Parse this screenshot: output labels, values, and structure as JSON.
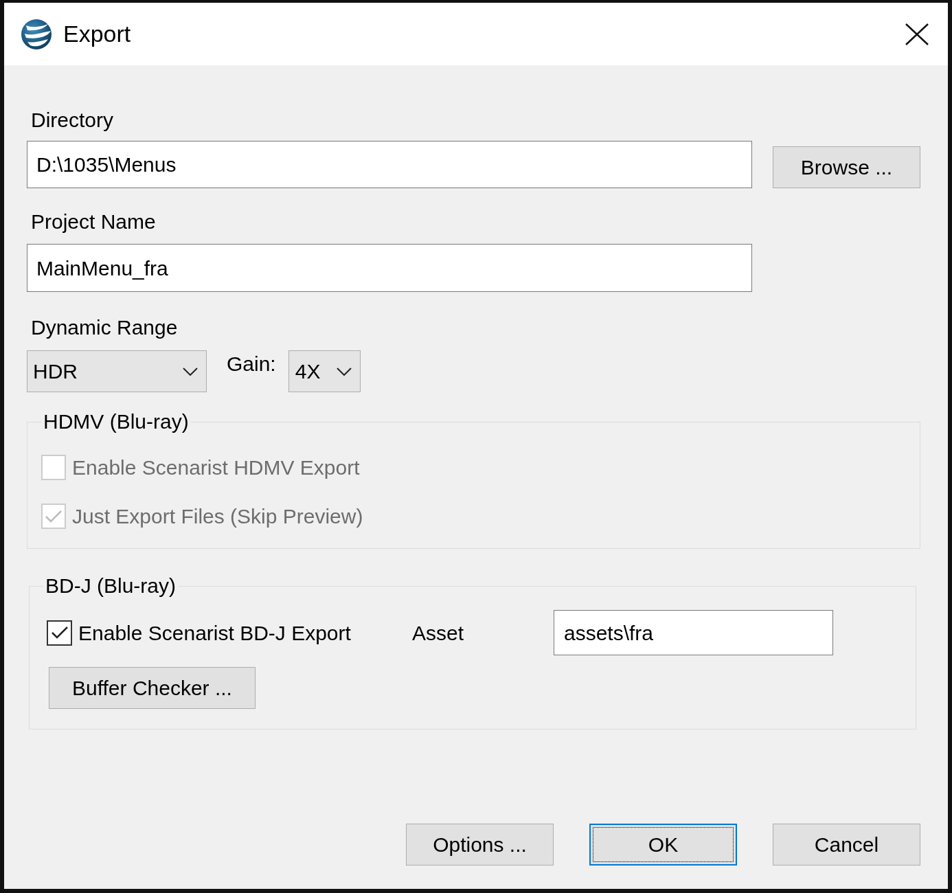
{
  "window": {
    "title": "Export"
  },
  "directory": {
    "label": "Directory",
    "value": "D:\\1035\\Menus",
    "button": "Browse ..."
  },
  "project_name": {
    "label": "Project Name",
    "value": "MainMenu_fra"
  },
  "dynamic_range": {
    "label": "Dynamic Range",
    "value": "HDR",
    "gain_label": "Gain:",
    "gain_value": "4X"
  },
  "hdmv": {
    "title": "HDMV (Blu-ray)",
    "options": [
      {
        "label": "Enable Scenarist HDMV Export",
        "checked": false,
        "disabled": true
      },
      {
        "label": "Just Export Files (Skip Preview)",
        "checked": true,
        "disabled": true
      }
    ]
  },
  "bdj": {
    "title": "BD-J (Blu-ray)",
    "option": {
      "label": "Enable Scenarist BD-J Export",
      "checked": true,
      "disabled": false
    },
    "asset_label": "Asset",
    "asset_value": "assets\\fra",
    "button": "Buffer Checker ..."
  },
  "buttons": [
    {
      "label": "Options ...",
      "focused": false
    },
    {
      "label": "OK",
      "focused": true
    },
    {
      "label": "Cancel",
      "focused": false
    }
  ]
}
